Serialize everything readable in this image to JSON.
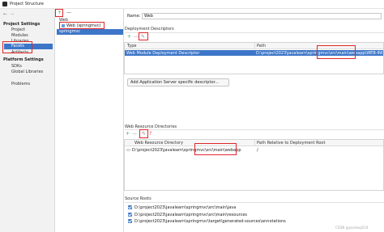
{
  "window": {
    "title": "Project Structure"
  },
  "nav": {
    "back_icon": "←",
    "forward_icon": "→",
    "project_settings_heading": "Project Settings",
    "project_settings_items": [
      "Project",
      "Modules",
      "Libraries",
      "Facets",
      "Artifacts"
    ],
    "selected_item": "Facets",
    "platform_settings_heading": "Platform Settings",
    "platform_settings_items": [
      "SDKs",
      "Global Libraries"
    ],
    "problems": "Problems"
  },
  "tree": {
    "add_icon": "+",
    "more_icon": "—",
    "group_label": "Web",
    "node_label": "Web (springmvc)",
    "selected_label": "springmvc"
  },
  "facet": {
    "name_label": "Name:",
    "name_value": "Web",
    "deployment_descriptors": {
      "title": "Deployment Descriptors",
      "toolbar": [
        "+",
        "—",
        "✎"
      ],
      "columns": [
        "Type",
        "Path"
      ],
      "rows": [
        {
          "type": "Web Module Deployment Descriptor",
          "path": "D:\\project2023\\javalearn\\springmvc\\src\\main\\webapp\\WEB-INF\\web.x"
        }
      ]
    },
    "add_server_button": "Add Application Server specific descriptor...",
    "web_resource_directories": {
      "title": "Web Resource Directories",
      "toolbar": [
        "+",
        "—",
        "✎",
        "?"
      ],
      "columns": [
        "Web Resource Directory",
        "Path Relative to Deployment Root"
      ],
      "rows": [
        {
          "directory": "D:\\project2023\\javalearn\\springmvc\\src\\main\\webapp",
          "relative": "/"
        }
      ]
    },
    "source_roots": {
      "title": "Source Roots",
      "items": [
        "D:\\project2023\\javalearn\\springmvc\\src\\main\\java",
        "D:\\project2023\\javalearn\\springmvc\\src\\main\\resources",
        "D:\\project2023\\javalearn\\springmvc\\target\\generated-sources\\annotations"
      ]
    }
  },
  "watermark": "CSDN @yanduqi534",
  "colors": {
    "selection": "#3d76c8",
    "highlight_box": "#e0262a",
    "add_icon": "#3aa55c",
    "remove_icon": "#d04040"
  }
}
